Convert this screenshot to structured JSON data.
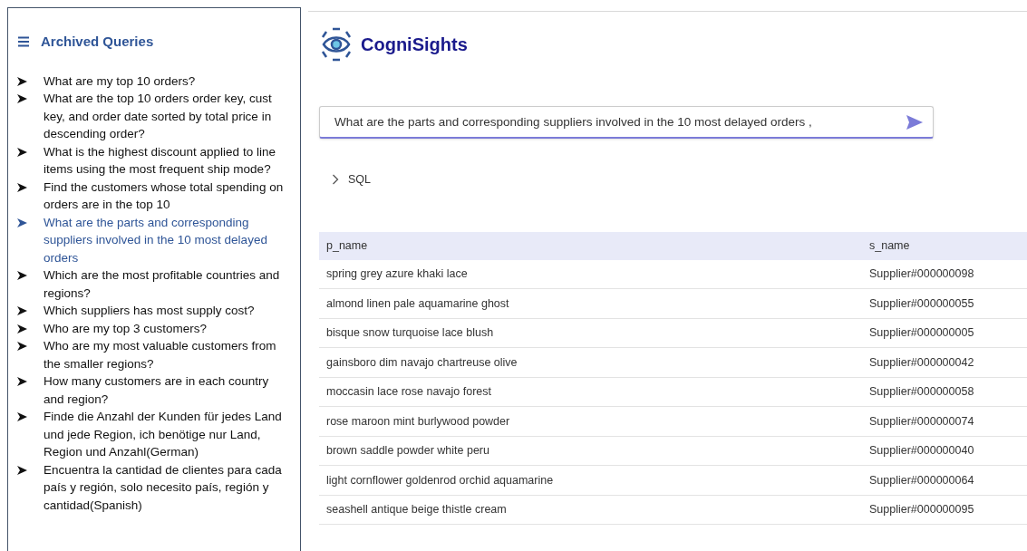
{
  "sidebar": {
    "title": "Archived Queries",
    "items": [
      {
        "text": "What are my top 10 orders?",
        "selected": false
      },
      {
        "text": "What are the top 10 orders order key, cust key, and order date sorted by total price in descending order?",
        "selected": false
      },
      {
        "text": "What is the highest discount applied to line items using the most frequent ship mode?",
        "selected": false
      },
      {
        "text": "Find the customers whose total spending on orders are in the top 10",
        "selected": false
      },
      {
        "text": "What are the parts and corresponding suppliers involved in the 10 most delayed orders",
        "selected": true
      },
      {
        "text": "Which are the most profitable countries and regions?",
        "selected": false
      },
      {
        "text": "Which suppliers has most supply cost?",
        "selected": false
      },
      {
        "text": "Who are my top 3 customers?",
        "selected": false
      },
      {
        "text": "Who are my most valuable customers from the smaller regions?",
        "selected": false
      },
      {
        "text": "How many customers are in each country and region?",
        "selected": false
      },
      {
        "text": "Finde die Anzahl der Kunden für jedes Land und jede Region, ich benötige nur Land, Region und Anzahl(German)",
        "selected": false
      },
      {
        "text": "Encuentra la cantidad de clientes para cada país y región, solo necesito país, región y cantidad(Spanish)",
        "selected": false
      }
    ]
  },
  "brand": "CogniSights",
  "query": {
    "value": "What are the parts and corresponding suppliers involved in the 10 most delayed orders ,"
  },
  "sql": {
    "label": "SQL",
    "expanded": false
  },
  "table": {
    "columns": [
      "p_name",
      "s_name"
    ],
    "rows": [
      [
        "spring grey azure khaki lace",
        "Supplier#000000098"
      ],
      [
        "almond linen pale aquamarine ghost",
        "Supplier#000000055"
      ],
      [
        "bisque snow turquoise lace blush",
        "Supplier#000000005"
      ],
      [
        "gainsboro dim navajo chartreuse olive",
        "Supplier#000000042"
      ],
      [
        "moccasin lace rose navajo forest",
        "Supplier#000000058"
      ],
      [
        "rose maroon mint burlywood powder",
        "Supplier#000000074"
      ],
      [
        "brown saddle powder white peru",
        "Supplier#000000040"
      ],
      [
        "light cornflower goldenrod orchid aquamarine",
        "Supplier#000000064"
      ],
      [
        "seashell antique beige thistle cream",
        "Supplier#000000095"
      ]
    ]
  }
}
